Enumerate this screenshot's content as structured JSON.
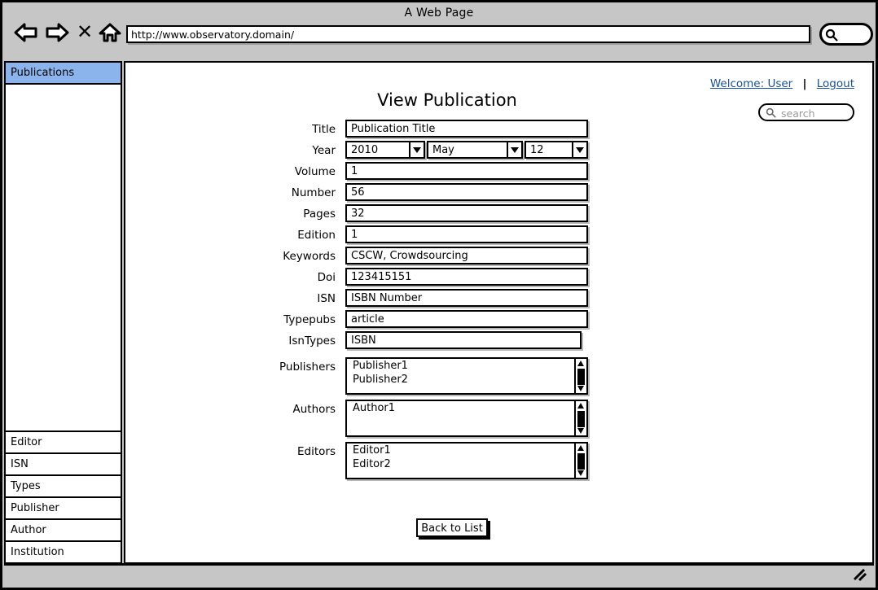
{
  "browser": {
    "window_title": "A Web Page",
    "url": "http://www.observatory.domain/",
    "nav": {
      "back_label": "back-arrow",
      "forward_label": "forward-arrow",
      "stop_label": "✕",
      "home_label": "home"
    },
    "search_icon": "magnifier-icon"
  },
  "sidebar": {
    "top_items": [
      {
        "label": "Publications",
        "selected": true
      }
    ],
    "bottom_items": [
      {
        "label": "Editor",
        "selected": false
      },
      {
        "label": "ISN",
        "selected": false
      },
      {
        "label": "Types",
        "selected": false
      },
      {
        "label": "Publisher",
        "selected": false
      },
      {
        "label": "Author",
        "selected": false
      },
      {
        "label": "Institution",
        "selected": false
      }
    ]
  },
  "header": {
    "welcome_label": "Welcome: User",
    "separator": "|",
    "logout_label": "Logout",
    "search_placeholder": "search",
    "search_value": ""
  },
  "main": {
    "page_title": "View Publication",
    "fields": {
      "title": {
        "label": "Title",
        "value": "Publication Title"
      },
      "year": {
        "label": "Year"
      },
      "volume": {
        "label": "Volume",
        "value": "1"
      },
      "number": {
        "label": "Number",
        "value": "56"
      },
      "pages": {
        "label": "Pages",
        "value": "32"
      },
      "edition": {
        "label": "Edition",
        "value": "1"
      },
      "keywords": {
        "label": "Keywords",
        "value": "CSCW, Crowdsourcing"
      },
      "doi": {
        "label": "Doi",
        "value": "123415151"
      },
      "isn": {
        "label": "ISN",
        "value": "ISBN Number"
      },
      "typepubs": {
        "label": "Typepubs",
        "value": "article"
      },
      "isntypes": {
        "label": "IsnTypes",
        "value": "ISBN"
      },
      "publishers": {
        "label": "Publishers",
        "items": [
          "Publisher1",
          "Publisher2"
        ]
      },
      "authors": {
        "label": "Authors",
        "items": [
          "Author1"
        ]
      },
      "editors": {
        "label": "Editors",
        "items": [
          "Editor1",
          "Editor2"
        ]
      }
    },
    "date": {
      "year_value": "2010",
      "month_value": "May",
      "day_value": "12"
    },
    "back_button_label": "Back to List"
  },
  "colors": {
    "selected_sidebar": "#8cb4ec",
    "link": "#16509c",
    "chrome": "#c6c6c6",
    "placeholder": "#9a9a9a"
  }
}
